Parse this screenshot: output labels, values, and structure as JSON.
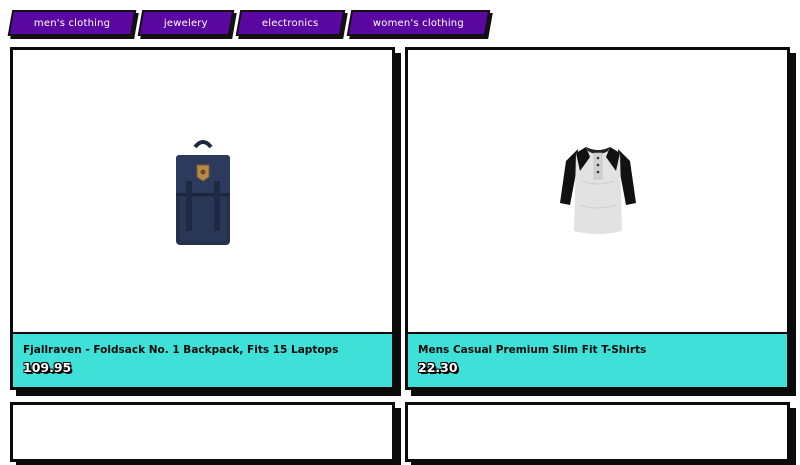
{
  "categories": [
    {
      "label": "men's clothing"
    },
    {
      "label": "jewelery"
    },
    {
      "label": "electronics"
    },
    {
      "label": "women's clothing"
    }
  ],
  "products": [
    {
      "title": "Fjallraven - Foldsack No. 1 Backpack, Fits 15 Laptops",
      "price": "109.95",
      "image": "backpack-image"
    },
    {
      "title": "Mens Casual Premium Slim Fit T-Shirts",
      "price": "22.30",
      "image": "tshirt-image"
    }
  ],
  "colors": {
    "category_bg": "#5b08a3",
    "info_bg": "#3ee0d8",
    "border": "#0b0b0b"
  }
}
